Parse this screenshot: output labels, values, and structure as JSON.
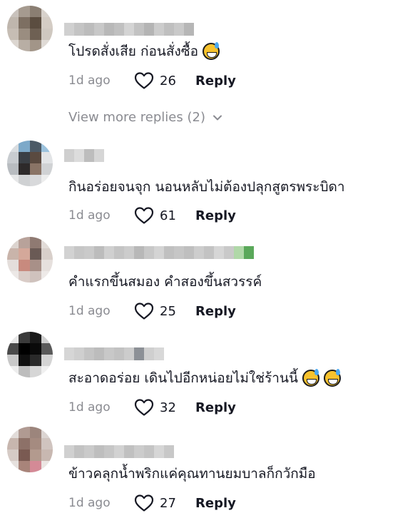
{
  "colors": {
    "text": "#161823",
    "muted": "#8a8b91",
    "emoji": "#f7c22d"
  },
  "view_more": {
    "label": "View more replies (2)",
    "icon": "chevron-down-icon"
  },
  "comments": [
    {
      "text": "โปรดสั่งเสีย ก่อนสั่งซื้อ",
      "emoji_count": 1,
      "time": "1d ago",
      "likes": "26",
      "reply_label": "Reply",
      "avatar_colors": [
        "#c9c2bc",
        "#a59a8f",
        "#8a7e72",
        "#d8d2cc",
        "#bfb6ad",
        "#7d6f62",
        "#5b4d40",
        "#d4ccc4",
        "#c6bdb4",
        "#9a8d80",
        "#6e6053",
        "#cfc8c0",
        "#dcd6d0",
        "#b8aea4",
        "#a29588",
        "#e0dbd6"
      ],
      "name_colors": [
        "#d0d0d0",
        "#c4c4c4",
        "#bcbcbc",
        "#c8c8c8",
        "#b8b8b8",
        "#c0c0c0",
        "#d4d4d4",
        "#c2c2c2",
        "#b4b4b4",
        "#cccccc",
        "#bfbfbf",
        "#c9c9c9",
        "#b6b6b6"
      ]
    },
    {
      "text": "กินอร่อยจนจุก นอนหลับไม่ต้องปลุกสูตรพระบิดา",
      "emoji_count": 0,
      "time": "1d ago",
      "likes": "61",
      "reply_label": "Reply",
      "avatar_colors": [
        "#d9dde0",
        "#7da9c9",
        "#4c5a66",
        "#9bc2dd",
        "#c8ccd0",
        "#3a3f45",
        "#5a4a40",
        "#e2e4e6",
        "#b8bcc0",
        "#2d2a2a",
        "#8a7466",
        "#d0d2d4",
        "#e6e7e8",
        "#cfd1d3",
        "#d8d9db",
        "#eceded"
      ],
      "name_colors": [
        "#cfcfcf",
        "#dcdcdc",
        "#bdbdbd",
        "#d6d6d6"
      ]
    },
    {
      "text": "คำแรกขึ้นสมอง คำสองขึ้นสวรรค์",
      "emoji_count": 0,
      "time": "1d ago",
      "likes": "25",
      "reply_label": "Reply",
      "avatar_colors": [
        "#dcd4cf",
        "#b8a29a",
        "#8f7a72",
        "#e2dcd8",
        "#c9b4aa",
        "#d4a89a",
        "#6a5a55",
        "#d8cfca",
        "#e4dedb",
        "#c88a7e",
        "#a89088",
        "#e6e0dd",
        "#ece8e6",
        "#d9ccc7",
        "#cfc2bd",
        "#eeeae8"
      ],
      "name_colors": [
        "#d2d2d2",
        "#c6c6c6",
        "#cacaca",
        "#bcbcbc",
        "#d0d0d0",
        "#c4c4c4",
        "#cccccc",
        "#b8b8b8",
        "#c8c8c8",
        "#d4d4d4",
        "#c0c0c0",
        "#c6c6c6",
        "#bfbfbf",
        "#cdcdcd",
        "#c3c3c3",
        "#d6d6d6",
        "#c9c9c9",
        "#b0d8a8",
        "#5aa85a"
      ]
    },
    {
      "text": "สะอาดอร่อย เดินไปอีกหน่อยไม่ใช่ร้านนี้",
      "emoji_count": 2,
      "time": "1d ago",
      "likes": "32",
      "reply_label": "Reply",
      "avatar_colors": [
        "#e8e8e8",
        "#3a3a3a",
        "#1a1a1a",
        "#cfcfcf",
        "#4a4a4a",
        "#000000",
        "#0a0a0a",
        "#5a5a5a",
        "#c8c8c8",
        "#101010",
        "#2a2a2a",
        "#d4d4d4",
        "#ededed",
        "#bdbdbd",
        "#d6d6d6",
        "#f0f0f0"
      ],
      "name_colors": [
        "#d6d6d6",
        "#cfcfcf",
        "#c4c4c4",
        "#bcbcbc",
        "#c8c8c8",
        "#c2c2c2",
        "#cccccc",
        "#8c9096",
        "#cfcfcf",
        "#d8d8d8"
      ]
    },
    {
      "text": "ข้าวคลุกน้ำพริกแค่คุณทานยมบาลก็กวักมือ",
      "emoji_count": 0,
      "time": "1d ago",
      "likes": "27",
      "reply_label": "Reply",
      "avatar_colors": [
        "#e2dcd9",
        "#b09a92",
        "#9c857c",
        "#dcd5d2",
        "#c7b6ae",
        "#8d7168",
        "#a58b80",
        "#d0c4bf",
        "#d6cbc6",
        "#7a5a52",
        "#b39a8e",
        "#c8b8b1",
        "#e6e1de",
        "#a8847a",
        "#d48a96",
        "#ebe6e3"
      ],
      "name_colors": [
        "#d0d0d0",
        "#c2c2c2",
        "#cacaca",
        "#bebebe",
        "#c6c6c6",
        "#d2d2d2",
        "#c0c0c0",
        "#cccccc",
        "#c4c4c4",
        "#d6d6d6",
        "#c8c8c8"
      ]
    }
  ]
}
